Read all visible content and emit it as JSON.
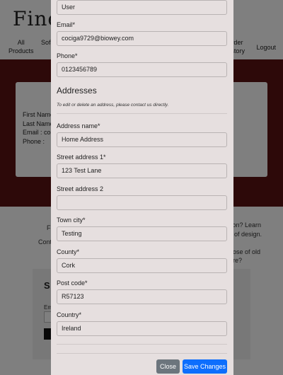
{
  "background": {
    "logo": "Fine",
    "nav_left": [
      {
        "line1": "All",
        "line2": "Products"
      },
      {
        "line1": "Sofa",
        "line2": ""
      }
    ],
    "nav_right": [
      {
        "line1": "Order",
        "line2": "History"
      },
      {
        "line1": "Logout",
        "line2": ""
      }
    ],
    "profile_lines": [
      "First Name",
      "Last Name",
      "Email : coc",
      "Phone :"
    ],
    "about_left": [
      "F",
      "Cont"
    ],
    "about_right": [
      "tion? Learn",
      "y of design.",
      "",
      "pose of old",
      "are?"
    ],
    "subscribe_title": "S",
    "subscribe_label": "Em",
    "colors": {
      "hero": "#5a1212"
    }
  },
  "modal": {
    "fields_top": [
      {
        "label": "",
        "value": "User"
      },
      {
        "label": "Email",
        "value": "cociga9729@biowey.com"
      },
      {
        "label": "Phone",
        "value": "0123456789"
      }
    ],
    "addresses_title": "Addresses",
    "addresses_note": "To edit or delete an address, please contact us directly.",
    "address_fields": [
      {
        "label": "Address name",
        "required": true,
        "value": "Home Address"
      },
      {
        "label": "Street address 1",
        "required": true,
        "value": "123 Test Lane"
      },
      {
        "label": "Street address 2",
        "required": false,
        "value": ""
      },
      {
        "label": "Town city",
        "required": true,
        "value": "Testing"
      },
      {
        "label": "County",
        "required": true,
        "value": "Cork"
      },
      {
        "label": "Post code",
        "required": true,
        "value": "R57123"
      },
      {
        "label": "Country",
        "required": true,
        "value": "Ireland"
      }
    ],
    "buttons": {
      "close": "Close",
      "save": "Save Changes"
    },
    "colors": {
      "close": "#6c757d",
      "save": "#0d6efd",
      "modal_bg": "#e6dfdf"
    }
  }
}
